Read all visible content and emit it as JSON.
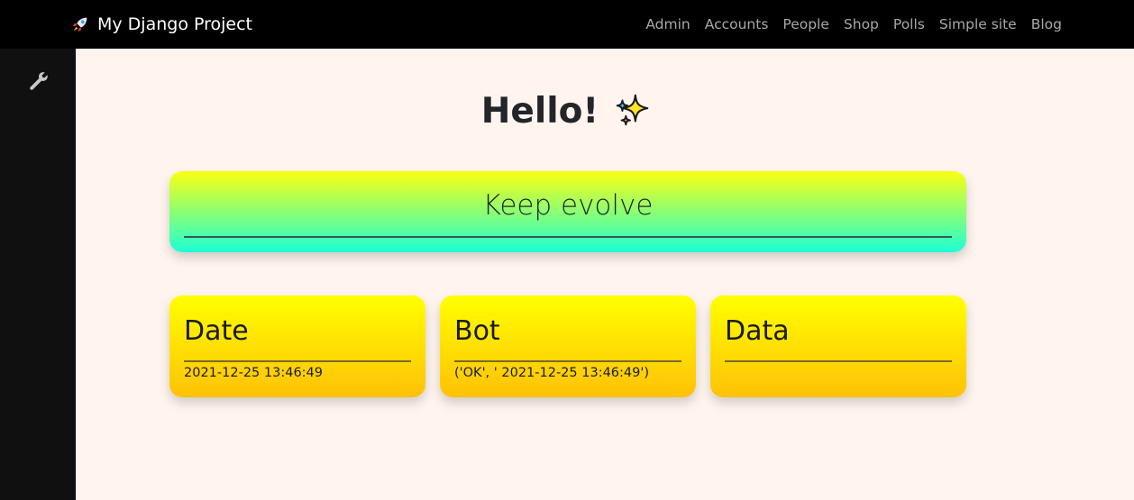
{
  "navbar": {
    "brand": "My Django Project",
    "brand_icon": "rocket-icon",
    "links": [
      "Admin",
      "Accounts",
      "People",
      "Shop",
      "Polls",
      "Simple site",
      "Blog"
    ]
  },
  "sidebar": {
    "icon": "wrench-icon"
  },
  "main": {
    "title": "Hello!",
    "title_icon": "sparkles-icon",
    "hero": {
      "text": "Keep evolve"
    },
    "cards": [
      {
        "title": "Date",
        "value": "2021-12-25 13:46:49"
      },
      {
        "title": "Bot",
        "value": "('OK', ' 2021-12-25 13:46:49')"
      },
      {
        "title": "Data",
        "value": ""
      }
    ]
  },
  "colors": {
    "navbar_bg": "#000000",
    "sidebar_bg": "#101010",
    "page_bg": "#fff5ee",
    "hero_gradient_top": "#fbff12",
    "hero_gradient_bottom": "#1dffd6",
    "card_gradient_top": "#ffff00",
    "card_gradient_bottom": "#ffc107"
  }
}
